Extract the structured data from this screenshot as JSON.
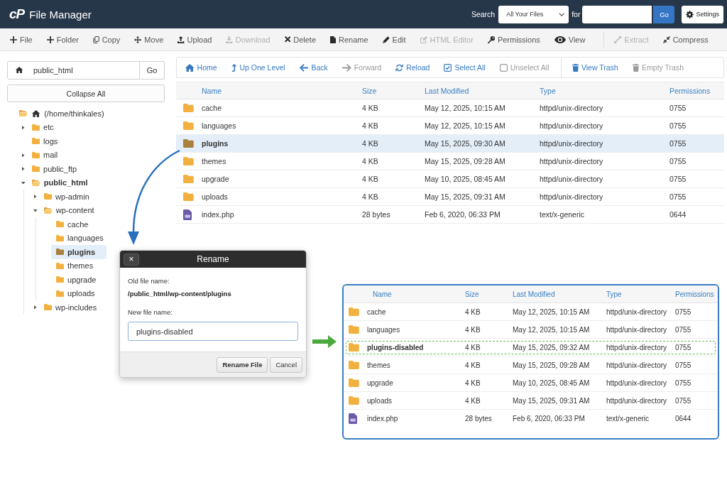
{
  "header": {
    "logo": "cP",
    "title": "File Manager",
    "search": {
      "label": "Search",
      "scope": "All Your Files",
      "for_label": "for",
      "button": "Go"
    },
    "settings": "Settings"
  },
  "toolbar": {
    "groups": [
      {
        "items": [
          {
            "kind": "new-file",
            "label": "File",
            "disabled": false
          },
          {
            "kind": "new-folder",
            "label": "Folder",
            "disabled": false
          },
          {
            "kind": "copy",
            "label": "Copy",
            "disabled": false
          },
          {
            "kind": "move",
            "label": "Move",
            "disabled": false
          },
          {
            "kind": "upload",
            "label": "Upload",
            "disabled": false
          },
          {
            "kind": "download",
            "label": "Download",
            "disabled": true
          },
          {
            "kind": "delete",
            "label": "Delete",
            "disabled": false
          },
          {
            "kind": "rename",
            "label": "Rename",
            "disabled": false
          },
          {
            "kind": "edit",
            "label": "Edit",
            "disabled": false
          },
          {
            "kind": "html-editor",
            "label": "HTML Editor",
            "disabled": true
          },
          {
            "kind": "permissions",
            "label": "Permissions",
            "disabled": false
          },
          {
            "kind": "view",
            "label": "View",
            "disabled": false
          }
        ]
      },
      {
        "items": [
          {
            "kind": "extract",
            "label": "Extract",
            "disabled": true
          },
          {
            "kind": "compress",
            "label": "Compress",
            "disabled": false
          }
        ]
      }
    ]
  },
  "sidebar": {
    "path_field": {
      "value": "public_html"
    },
    "go": "Go",
    "collapse_all": "Collapse All",
    "tree": {
      "label": "(/home/thinkales)",
      "expanded": true,
      "current": false,
      "selected": false,
      "children": [
        {
          "label": "etc",
          "expandable": true,
          "expanded": false,
          "current": false,
          "selected": false
        },
        {
          "label": "logs",
          "expandable": false,
          "expanded": false,
          "current": false,
          "selected": false
        },
        {
          "label": "mail",
          "expandable": true,
          "expanded": false,
          "current": false,
          "selected": false
        },
        {
          "label": "public_ftp",
          "expandable": true,
          "expanded": false,
          "current": false,
          "selected": false
        },
        {
          "label": "public_html",
          "expandable": true,
          "expanded": true,
          "current": true,
          "selected": false,
          "children": [
            {
              "label": "wp-admin",
              "expandable": true,
              "expanded": false,
              "current": false,
              "selected": false
            },
            {
              "label": "wp-content",
              "expandable": true,
              "expanded": true,
              "current": false,
              "selected": false,
              "children": [
                {
                  "label": "cache",
                  "expandable": false,
                  "expanded": false,
                  "current": false,
                  "selected": false
                },
                {
                  "label": "languages",
                  "expandable": false,
                  "expanded": false,
                  "current": false,
                  "selected": false
                },
                {
                  "label": "plugins",
                  "expandable": false,
                  "expanded": false,
                  "current": false,
                  "selected": true
                },
                {
                  "label": "themes",
                  "expandable": false,
                  "expanded": false,
                  "current": false,
                  "selected": false
                },
                {
                  "label": "upgrade",
                  "expandable": false,
                  "expanded": false,
                  "current": false,
                  "selected": false
                },
                {
                  "label": "uploads",
                  "expandable": false,
                  "expanded": false,
                  "current": false,
                  "selected": false
                }
              ]
            },
            {
              "label": "wp-includes",
              "expandable": true,
              "expanded": false,
              "current": false,
              "selected": false
            }
          ]
        }
      ]
    }
  },
  "navigation": {
    "groups": [
      {
        "items": [
          {
            "kind": "home",
            "label": "Home",
            "disabled": false
          },
          {
            "kind": "up-one-level",
            "label": "Up One Level",
            "disabled": false
          },
          {
            "kind": "back",
            "label": "Back",
            "disabled": false
          },
          {
            "kind": "forward",
            "label": "Forward",
            "disabled": true
          },
          {
            "kind": "reload",
            "label": "Reload",
            "disabled": false
          },
          {
            "kind": "select-all",
            "label": "Select All",
            "disabled": false
          },
          {
            "kind": "unselect-all",
            "label": "Unselect All",
            "disabled": true
          }
        ]
      },
      {
        "items": [
          {
            "kind": "view-trash",
            "label": "View Trash",
            "disabled": false
          },
          {
            "kind": "empty-trash",
            "label": "Empty Trash",
            "disabled": true
          }
        ]
      }
    ]
  },
  "file_table": {
    "columns": [
      "Name",
      "Size",
      "Last Modified",
      "Type",
      "Permissions"
    ],
    "rows": [
      {
        "kind": "folder",
        "name": "cache",
        "size": "4 KB",
        "modified": "May 12, 2025, 10:15 AM",
        "type": "httpd/unix-directory",
        "permissions": "0755",
        "selected": false
      },
      {
        "kind": "folder",
        "name": "languages",
        "size": "4 KB",
        "modified": "May 12, 2025, 10:15 AM",
        "type": "httpd/unix-directory",
        "permissions": "0755",
        "selected": false
      },
      {
        "kind": "folder",
        "name": "plugins",
        "size": "4 KB",
        "modified": "May 15, 2025, 09:30 AM",
        "type": "httpd/unix-directory",
        "permissions": "0755",
        "selected": true
      },
      {
        "kind": "folder",
        "name": "themes",
        "size": "4 KB",
        "modified": "May 15, 2025, 09:28 AM",
        "type": "httpd/unix-directory",
        "permissions": "0755",
        "selected": false
      },
      {
        "kind": "folder",
        "name": "upgrade",
        "size": "4 KB",
        "modified": "May 10, 2025, 08:45 AM",
        "type": "httpd/unix-directory",
        "permissions": "0755",
        "selected": false
      },
      {
        "kind": "folder",
        "name": "uploads",
        "size": "4 KB",
        "modified": "May 15, 2025, 09:31 AM",
        "type": "httpd/unix-directory",
        "permissions": "0755",
        "selected": false
      },
      {
        "kind": "file",
        "name": "index.php",
        "size": "28 bytes",
        "modified": "Feb 6, 2020, 06:33 PM",
        "type": "text/x-generic",
        "permissions": "0644",
        "selected": false
      }
    ]
  },
  "rename_dialog": {
    "title": "Rename",
    "close": "×",
    "old_label": "Old file name:",
    "old_value": "/public_html/wp-content/plugins",
    "new_label": "New file name:",
    "new_value": "plugins-disabled",
    "buttons": [
      {
        "kind": "confirm",
        "label": "Rename File"
      },
      {
        "kind": "cancel",
        "label": "Cancel"
      }
    ]
  },
  "result_table": {
    "columns": [
      "Name",
      "Size",
      "Last Modified",
      "Type",
      "Permissions"
    ],
    "rows": [
      {
        "kind": "folder",
        "name": "cache",
        "size": "4 KB",
        "modified": "May 12, 2025, 10:15 AM",
        "type": "httpd/unix-directory",
        "permissions": "0755",
        "highlighted": false
      },
      {
        "kind": "folder",
        "name": "languages",
        "size": "4 KB",
        "modified": "May 12, 2025, 10:15 AM",
        "type": "httpd/unix-directory",
        "permissions": "0755",
        "highlighted": false
      },
      {
        "kind": "folder",
        "name": "plugins-disabled",
        "size": "4 KB",
        "modified": "May 15, 2025, 09:32 AM",
        "type": "httpd/unix-directory",
        "permissions": "0755",
        "highlighted": true
      },
      {
        "kind": "folder",
        "name": "themes",
        "size": "4 KB",
        "modified": "May 15, 2025, 09:28 AM",
        "type": "httpd/unix-directory",
        "permissions": "0755",
        "highlighted": false
      },
      {
        "kind": "folder",
        "name": "upgrade",
        "size": "4 KB",
        "modified": "May 10, 2025, 08:45 AM",
        "type": "httpd/unix-directory",
        "permissions": "0755",
        "highlighted": false
      },
      {
        "kind": "folder",
        "name": "uploads",
        "size": "4 KB",
        "modified": "May 15, 2025, 09:31 AM",
        "type": "httpd/unix-directory",
        "permissions": "0755",
        "highlighted": false
      },
      {
        "kind": "file",
        "name": "index.php",
        "size": "28 bytes",
        "modified": "Feb 6, 2020, 06:33 PM",
        "type": "text/x-generic",
        "permissions": "0644",
        "highlighted": false
      }
    ]
  }
}
